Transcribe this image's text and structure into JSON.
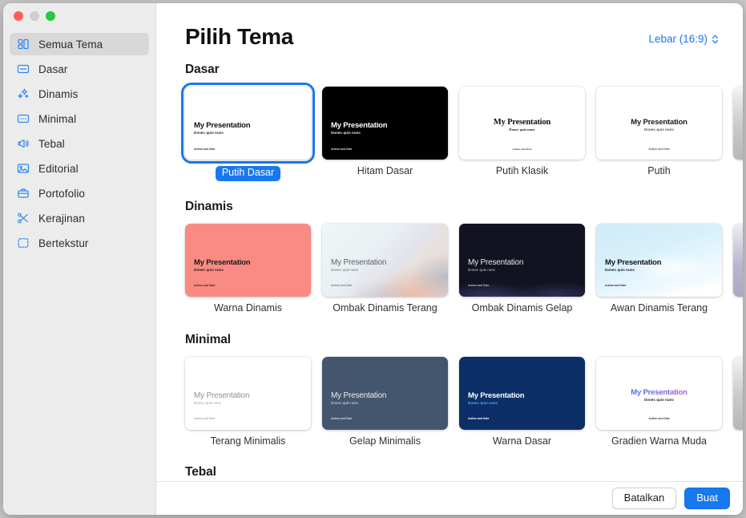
{
  "window": {
    "traffic_lights": [
      "close",
      "minimize",
      "zoom"
    ]
  },
  "sidebar": {
    "items": [
      {
        "label": "Semua Tema",
        "icon": "grid-icon",
        "selected": true
      },
      {
        "label": "Dasar",
        "icon": "slide-icon",
        "selected": false
      },
      {
        "label": "Dinamis",
        "icon": "sparkles-icon",
        "selected": false
      },
      {
        "label": "Minimal",
        "icon": "dots-slide-icon",
        "selected": false
      },
      {
        "label": "Tebal",
        "icon": "megaphone-icon",
        "selected": false
      },
      {
        "label": "Editorial",
        "icon": "photo-icon",
        "selected": false
      },
      {
        "label": "Portofolio",
        "icon": "briefcase-icon",
        "selected": false
      },
      {
        "label": "Kerajinan",
        "icon": "scissors-icon",
        "selected": false
      },
      {
        "label": "Bertekstur",
        "icon": "frame-icon",
        "selected": false
      }
    ]
  },
  "header": {
    "title": "Pilih Tema",
    "aspect_ratio": "Lebar (16:9)"
  },
  "slide_text": {
    "title": "My Presentation",
    "subtitle": "Donec quis nunc",
    "footer": "Author and Date"
  },
  "sections": [
    {
      "title": "Dasar",
      "themes": [
        {
          "label": "Putih Dasar",
          "selected": true,
          "style": "white-basic"
        },
        {
          "label": "Hitam Dasar",
          "selected": false,
          "style": "black-basic"
        },
        {
          "label": "Putih Klasik",
          "selected": false,
          "style": "white-classic"
        },
        {
          "label": "Putih",
          "selected": false,
          "style": "white-plain"
        },
        {
          "label": "",
          "selected": false,
          "style": "peek-light"
        }
      ]
    },
    {
      "title": "Dinamis",
      "themes": [
        {
          "label": "Warna Dinamis",
          "selected": false,
          "style": "coral"
        },
        {
          "label": "Ombak Dinamis Terang",
          "selected": false,
          "style": "wave-light"
        },
        {
          "label": "Ombak Dinamis Gelap",
          "selected": false,
          "style": "wave-dark"
        },
        {
          "label": "Awan Dinamis Terang",
          "selected": false,
          "style": "cloud-light"
        },
        {
          "label": "",
          "selected": false,
          "style": "peek-lavender"
        }
      ]
    },
    {
      "title": "Minimal",
      "themes": [
        {
          "label": "Terang Minimalis",
          "selected": false,
          "style": "minimal-light"
        },
        {
          "label": "Gelap Minimalis",
          "selected": false,
          "style": "minimal-dark"
        },
        {
          "label": "Warna Dasar",
          "selected": false,
          "style": "navy"
        },
        {
          "label": "Gradien Warna Muda",
          "selected": false,
          "style": "gradient-title"
        },
        {
          "label": "",
          "selected": false,
          "style": "peek-light"
        }
      ]
    },
    {
      "title": "Tebal",
      "themes": []
    }
  ],
  "footer": {
    "cancel_label": "Batalkan",
    "create_label": "Buat"
  },
  "colors": {
    "accent": "#1878f0",
    "sidebar_bg": "#ececec",
    "selected_row_bg": "#d8d8d8",
    "coral": "#f98b83",
    "minimal_dark": "#44566e",
    "navy": "#0b2f66",
    "wave_dark": "#131520"
  }
}
